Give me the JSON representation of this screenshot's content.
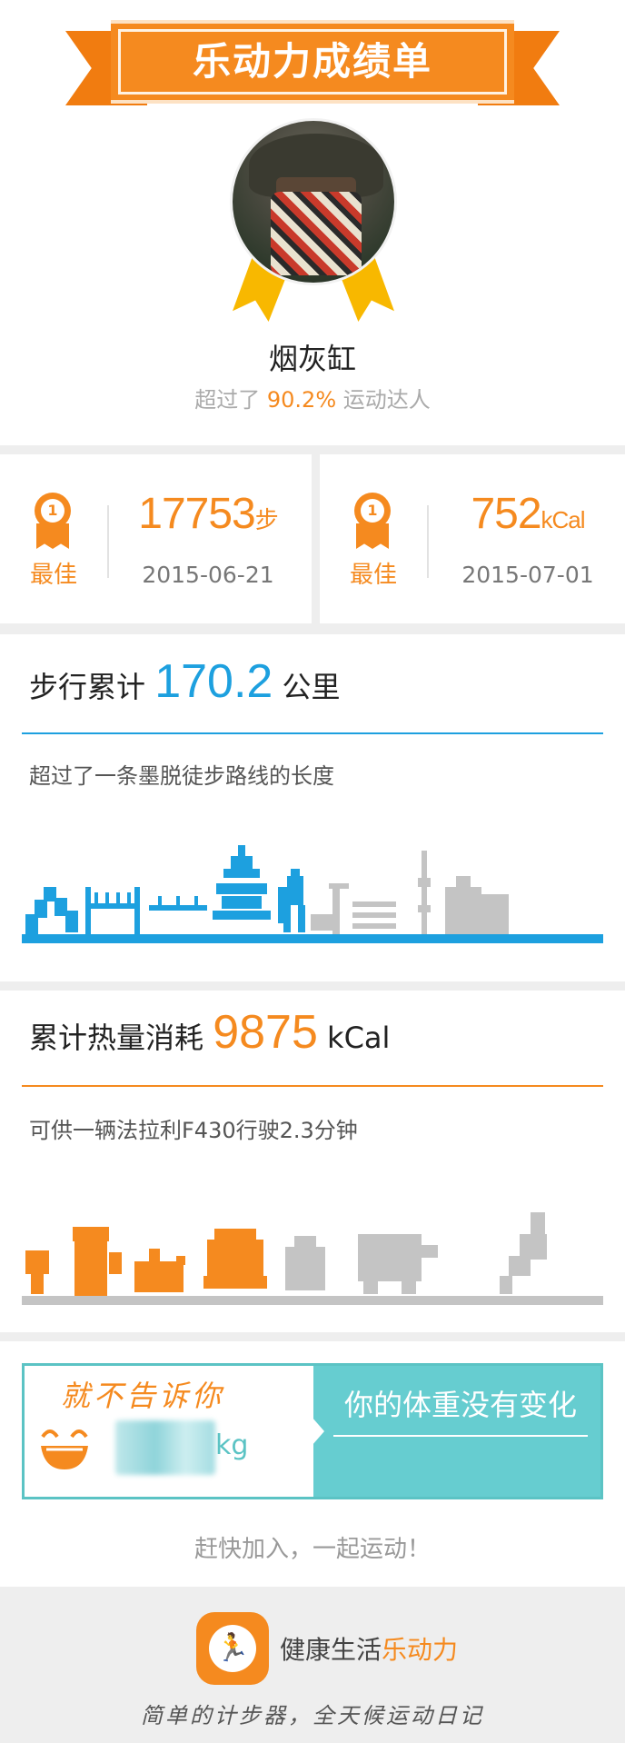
{
  "header": {
    "title": "乐动力成绩单",
    "username": "烟灰缸",
    "rank_prefix": "超过了",
    "rank_pct": "90.2%",
    "rank_suffix": "运动达人"
  },
  "best_records": [
    {
      "rank": "1",
      "label": "最佳",
      "value": "17753",
      "unit": "步",
      "date": "2015-06-21"
    },
    {
      "rank": "1",
      "label": "最佳",
      "value": "752",
      "unit": "kCal",
      "date": "2015-07-01"
    }
  ],
  "walking": {
    "title_prefix": "步行累计",
    "value": "170.2",
    "unit": "公里",
    "description": "超过了一条墨脱徒步路线的长度",
    "accent_color": "#1da0df",
    "progress": 0.51
  },
  "calories": {
    "title_prefix": "累计热量消耗",
    "value": "9875",
    "unit": "kCal",
    "description": "可供一辆法拉利F430行驶2.3分钟",
    "accent_color": "#f58a1f",
    "progress": 0.39
  },
  "weight": {
    "hidden_text": "就不告诉你",
    "unit": "kg",
    "status": "你的体重没有变化"
  },
  "cta": "赶快加入，一起运动！",
  "footer": {
    "app_name_prefix": "健康生活",
    "app_name_accent": "乐动力",
    "slogan": "简单的计步器，全天候运动日记"
  },
  "icons": [
    "medal-icon",
    "smile-icon",
    "runner-icon"
  ]
}
